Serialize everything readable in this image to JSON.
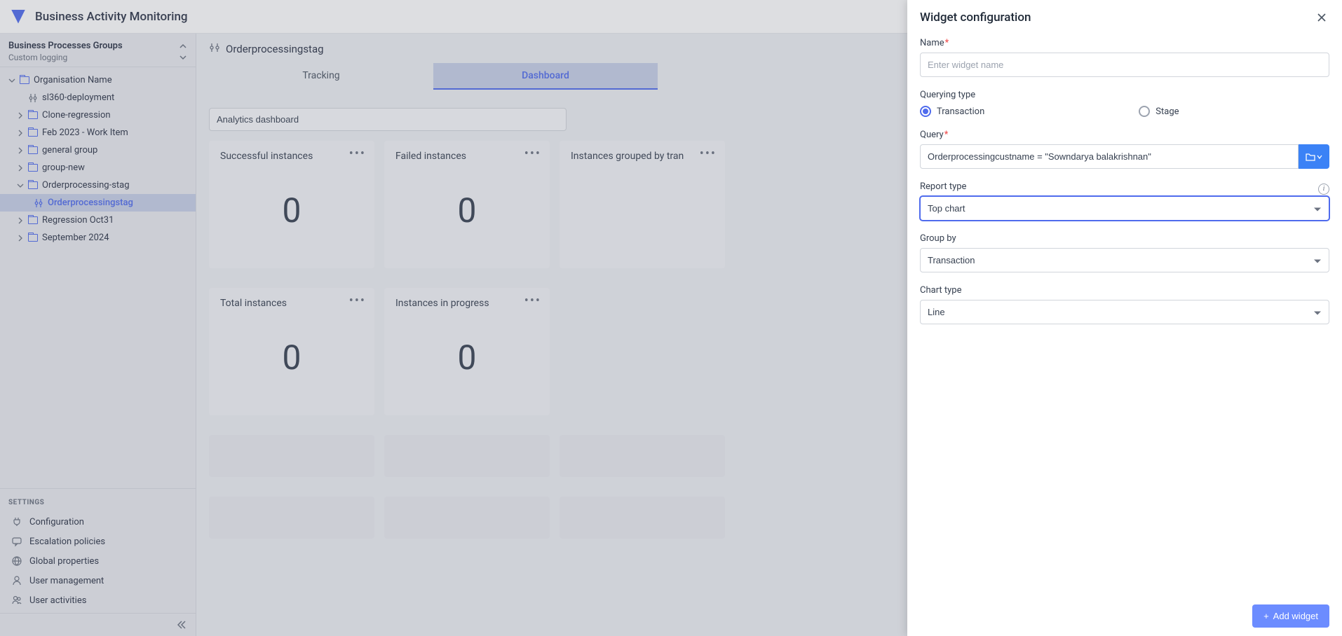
{
  "header": {
    "title": "Business Activity Monitoring"
  },
  "sidebar": {
    "groups_title": "Business Processes Groups",
    "groups_sub": "Custom logging",
    "org_name": "Organisation Name",
    "tree": [
      {
        "label": "sl360-deployment",
        "type": "process"
      },
      {
        "label": "Clone-regression",
        "type": "folder",
        "expandable": true
      },
      {
        "label": "Feb 2023 - Work Item",
        "type": "folder",
        "expandable": true
      },
      {
        "label": "general group",
        "type": "folder",
        "expandable": true
      },
      {
        "label": "group-new",
        "type": "folder",
        "expandable": true
      },
      {
        "label": "Orderprocessing-stag",
        "type": "folder",
        "expandable": true,
        "expanded": true,
        "children": [
          {
            "label": "Orderprocessingstag",
            "type": "process",
            "selected": true
          }
        ]
      },
      {
        "label": "Regression Oct31",
        "type": "folder",
        "expandable": true
      },
      {
        "label": "September 2024",
        "type": "folder",
        "expandable": true
      }
    ],
    "settings_head": "SETTINGS",
    "settings": [
      {
        "label": "Configuration",
        "icon": "plug"
      },
      {
        "label": "Escalation policies",
        "icon": "chat"
      },
      {
        "label": "Global properties",
        "icon": "globe"
      },
      {
        "label": "User management",
        "icon": "user"
      },
      {
        "label": "User activities",
        "icon": "users"
      }
    ]
  },
  "main": {
    "page_title": "Orderprocessingstag",
    "tabs": [
      {
        "label": "Tracking",
        "active": false
      },
      {
        "label": "Dashboard",
        "active": true
      }
    ],
    "dashboard_name": "Analytics dashboard",
    "widgets": [
      {
        "title": "Successful instances",
        "value": "0"
      },
      {
        "title": "Failed instances",
        "value": "0"
      },
      {
        "title": "Instances grouped by tran",
        "value": ""
      },
      {
        "title": "Total instances",
        "value": "0"
      },
      {
        "title": "Instances in progress",
        "value": "0"
      }
    ]
  },
  "panel": {
    "title": "Widget configuration",
    "name_label": "Name",
    "name_placeholder": "Enter widget name",
    "querying_type_label": "Querying type",
    "querying_options": {
      "transaction": "Transaction",
      "stage": "Stage"
    },
    "query_label": "Query",
    "query_value": "Orderprocessingcustname = \"Sowndarya balakrishnan\"",
    "report_type_label": "Report type",
    "report_type_value": "Top chart",
    "group_by_label": "Group by",
    "group_by_value": "Transaction",
    "chart_type_label": "Chart type",
    "chart_type_value": "Line",
    "add_button": "Add widget"
  }
}
